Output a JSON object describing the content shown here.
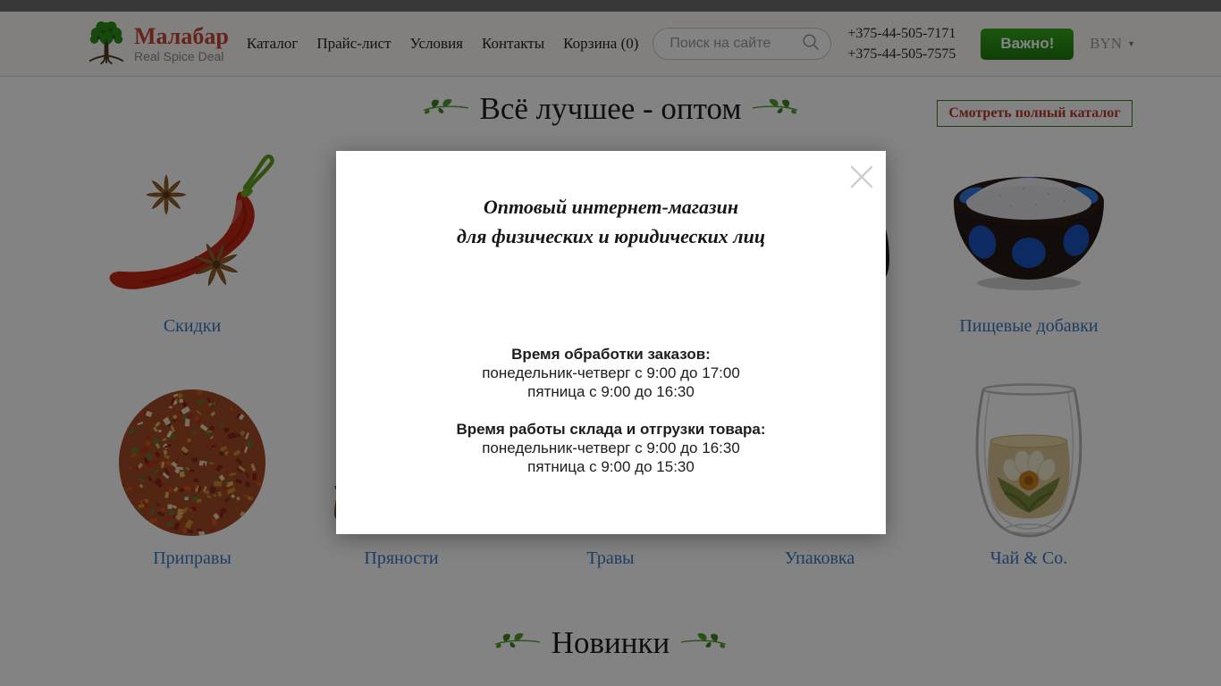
{
  "header": {
    "brand": {
      "name": "Малабар",
      "tagline": "Real Spice Deal"
    },
    "nav": [
      {
        "label": "Каталог"
      },
      {
        "label": "Прайс-лист"
      },
      {
        "label": "Условия"
      },
      {
        "label": "Контакты"
      },
      {
        "label": "Корзина (0)"
      }
    ],
    "search": {
      "placeholder": "Поиск на сайте"
    },
    "phones": [
      "+375-44-505-7171",
      "+375-44-505-7575"
    ],
    "important_button": "Важно!",
    "currency": {
      "code": "BYN"
    }
  },
  "main": {
    "heading": "Всё лучшее - оптом",
    "catalog_button": "Смотреть полный каталог",
    "categories_row1": [
      {
        "label": "Скидки"
      },
      {
        "label": ""
      },
      {
        "label": ""
      },
      {
        "label": ""
      },
      {
        "label": "Пищевые добавки"
      }
    ],
    "categories_row2": [
      {
        "label": "Приправы"
      },
      {
        "label": "Пряности"
      },
      {
        "label": "Травы"
      },
      {
        "label": "Упаковка"
      },
      {
        "label": "Чай & Co."
      }
    ],
    "new_heading": "Новинки"
  },
  "modal": {
    "title_line1": "Оптовый интернет-магазин",
    "title_line2": "для физических и юридических лиц",
    "sections": [
      {
        "title": "Время обработки заказов:",
        "lines": [
          "понедельник-четверг с 9:00 до 17:00",
          "пятница с 9:00 до 16:30"
        ]
      },
      {
        "title": "Время работы склада и отгрузки товара:",
        "lines": [
          "понедельник-четверг с 9:00 до 16:30",
          "пятница с 9:00 до 15:30"
        ]
      }
    ]
  },
  "icons": {
    "logo": "tree-icon",
    "search": "magnifier-icon",
    "currency": "caret-down-icon",
    "modal_close": "x-close-icon",
    "heading_decor": "leaf-branch-icon"
  },
  "colors": {
    "brand_red": "#c74434",
    "accent_green": "#2f8c1a",
    "button_green": "#2a9416",
    "link_blue": "#3a77c2",
    "catalog_btn_text": "#b8382a",
    "overlay": "rgba(0,0,0,0.485)"
  }
}
